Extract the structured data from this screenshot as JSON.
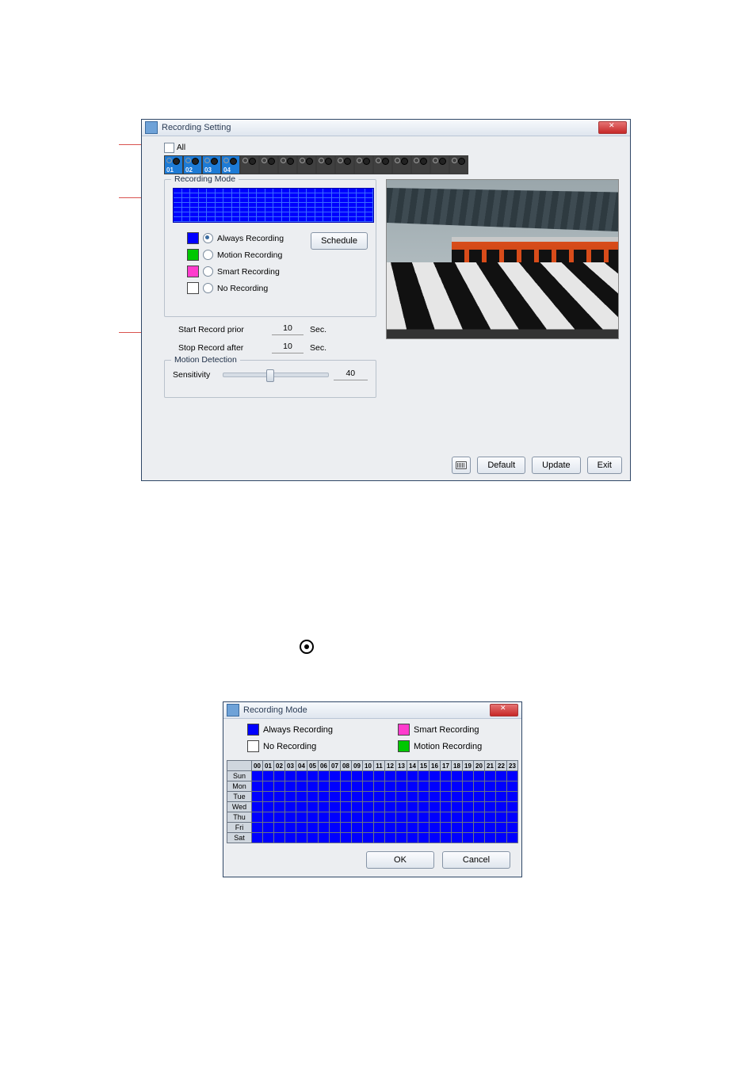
{
  "dlg1": {
    "title": "Recording Setting",
    "all_label": "All",
    "channels_selected": [
      "01",
      "02",
      "03",
      "04"
    ],
    "group_recording": "Recording Mode",
    "modes": {
      "always": "Always Recording",
      "motion": "Motion Recording",
      "smart": "Smart Recording",
      "none": "No Recording"
    },
    "schedule_btn": "Schedule",
    "start_prior_lbl": "Start Record prior",
    "start_prior_val": "10",
    "stop_after_lbl": "Stop Record after",
    "stop_after_val": "10",
    "sec": "Sec.",
    "group_motion": "Motion Detection",
    "sensitivity_lbl": "Sensitivity",
    "sensitivity_val": "40",
    "btn_default": "Default",
    "btn_update": "Update",
    "btn_exit": "Exit"
  },
  "dlg2": {
    "title": "Recording Mode",
    "legend": {
      "always": "Always Recording",
      "smart": "Smart Recording",
      "none": "No Recording",
      "motion": "Motion Recording"
    },
    "hours": [
      "00",
      "01",
      "02",
      "03",
      "04",
      "05",
      "06",
      "07",
      "08",
      "09",
      "10",
      "11",
      "12",
      "13",
      "14",
      "15",
      "16",
      "17",
      "18",
      "19",
      "20",
      "21",
      "22",
      "23"
    ],
    "days": [
      "Sun",
      "Mon",
      "Tue",
      "Wed",
      "Thu",
      "Fri",
      "Sat"
    ],
    "ok": "OK",
    "cancel": "Cancel"
  },
  "chart_data": {
    "type": "heatmap",
    "title": "Recording Mode weekly schedule",
    "x": [
      "00",
      "01",
      "02",
      "03",
      "04",
      "05",
      "06",
      "07",
      "08",
      "09",
      "10",
      "11",
      "12",
      "13",
      "14",
      "15",
      "16",
      "17",
      "18",
      "19",
      "20",
      "21",
      "22",
      "23"
    ],
    "y": [
      "Sun",
      "Mon",
      "Tue",
      "Wed",
      "Thu",
      "Fri",
      "Sat"
    ],
    "legend": {
      "always": "Always Recording",
      "smart": "Smart Recording",
      "none": "No Recording",
      "motion": "Motion Recording"
    },
    "values_note": "all cells = Always Recording"
  }
}
